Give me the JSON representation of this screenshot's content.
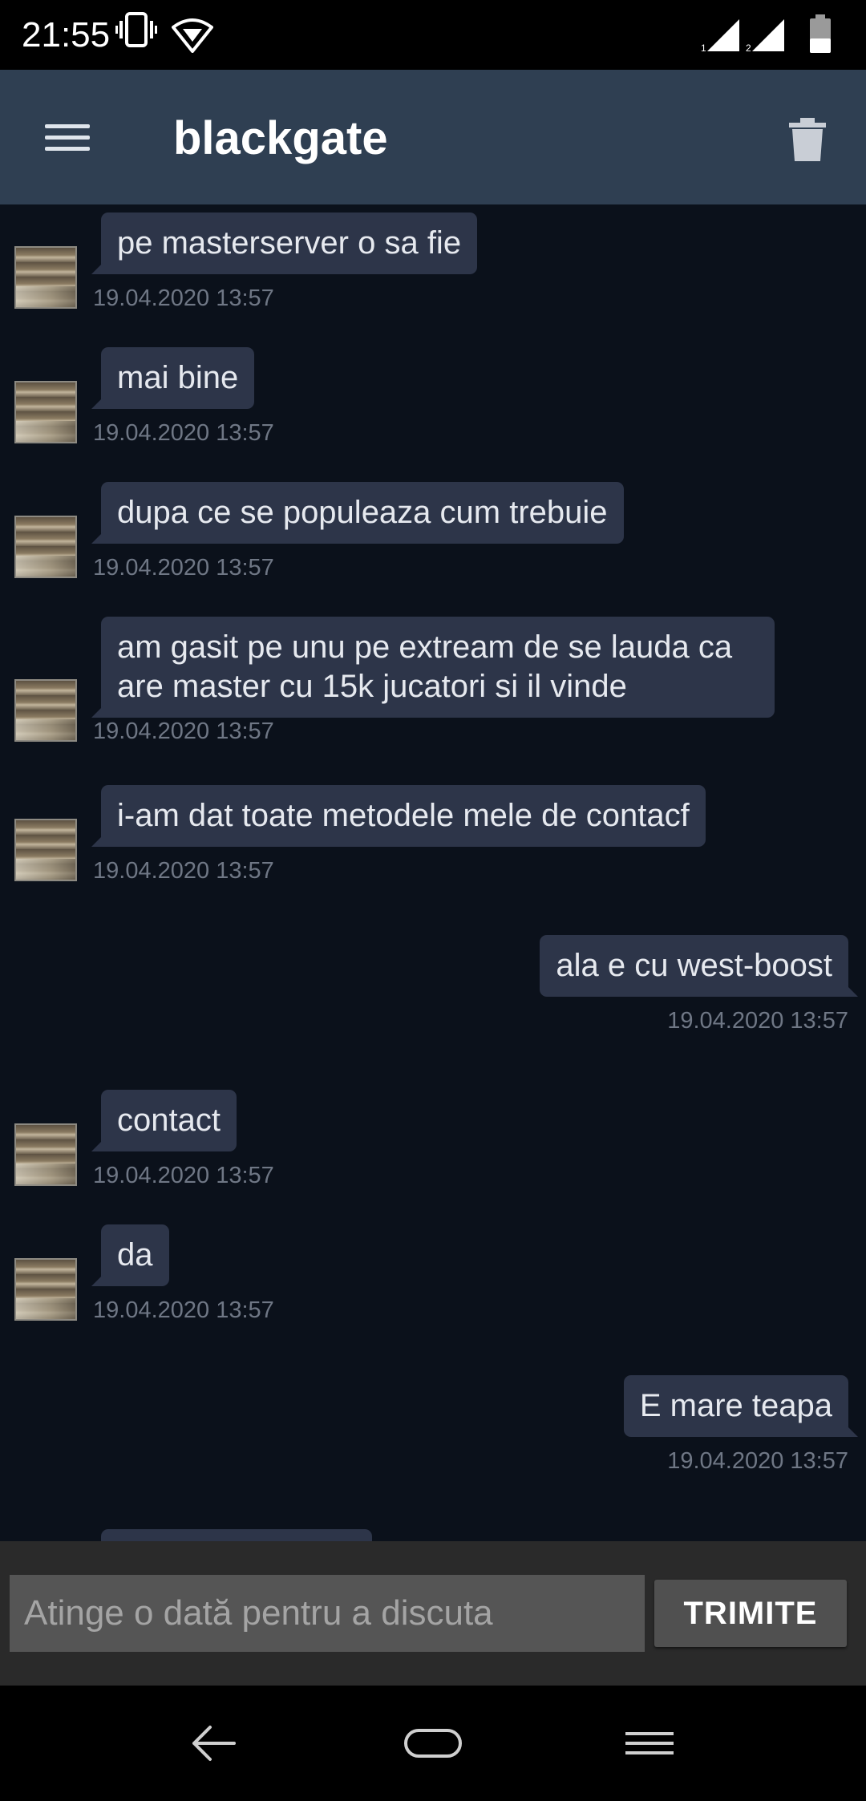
{
  "status_bar": {
    "time": "21:55",
    "icons": [
      "vibrate-icon",
      "wifi-icon",
      "signal-sim1-icon",
      "signal-sim2-icon",
      "battery-icon"
    ],
    "sim1_label": "1",
    "sim2_label": "2"
  },
  "app_bar": {
    "title": "blackgate",
    "menu_icon": "hamburger-menu-icon",
    "delete_icon": "trash-icon",
    "background": "#2f3f52"
  },
  "messages": [
    {
      "direction": "in",
      "text": "pe masterserver o sa fie",
      "timestamp": "19.04.2020 13:57"
    },
    {
      "direction": "in",
      "text": "mai bine",
      "timestamp": "19.04.2020 13:57"
    },
    {
      "direction": "in",
      "text": "dupa ce se populeaza cum trebuie",
      "timestamp": "19.04.2020 13:57"
    },
    {
      "direction": "in",
      "text": "am gasit pe unu pe extream de se lauda ca are master cu 15k jucatori si il vinde",
      "timestamp": "19.04.2020 13:57"
    },
    {
      "direction": "in",
      "text": "i-am dat toate metodele mele de contacf",
      "timestamp": "19.04.2020 13:57"
    },
    {
      "direction": "out",
      "text": "ala e cu west-boost",
      "timestamp": "19.04.2020 13:57"
    },
    {
      "direction": "in",
      "text": "contact",
      "timestamp": "19.04.2020 13:57"
    },
    {
      "direction": "in",
      "text": "da",
      "timestamp": "19.04.2020 13:57"
    },
    {
      "direction": "out",
      "text": "E mare teapa",
      "timestamp": "19.04.2020 13:57"
    }
  ],
  "composer": {
    "placeholder": "Atinge o dată pentru a discuta",
    "value": "",
    "send_label": "TRIMITE"
  },
  "nav_bar": {
    "icons": [
      "back-icon",
      "home-icon",
      "recents-icon"
    ]
  },
  "colors": {
    "chat_background": "#0b111b",
    "bubble": "#2d3549",
    "timestamp": "#6f7785",
    "composer_background": "#2a2a2a"
  }
}
